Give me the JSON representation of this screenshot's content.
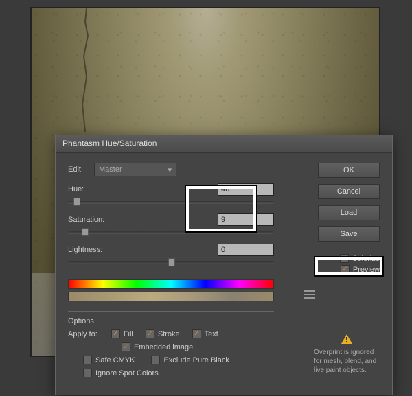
{
  "dialog": {
    "title": "Phantasm Hue/Saturation",
    "edit_label": "Edit:",
    "edit_value": "Master",
    "hue_label": "Hue:",
    "hue_value": "46",
    "sat_label": "Saturation:",
    "sat_value": "9",
    "light_label": "Lightness:",
    "light_value": "0"
  },
  "buttons": {
    "ok": "OK",
    "cancel": "Cancel",
    "load": "Load",
    "save": "Save"
  },
  "checks": {
    "colorize": "Colorize",
    "preview": "Preview"
  },
  "options": {
    "title": "Options",
    "apply_to": "Apply to:",
    "fill": "Fill",
    "stroke": "Stroke",
    "text": "Text",
    "embedded": "Embedded image",
    "safe_cmyk": "Safe CMYK",
    "exclude_black": "Exclude Pure Black",
    "ignore_spot": "Ignore Spot Colors"
  },
  "note": "Overprint is ignored for mesh, blend, and live paint objects."
}
